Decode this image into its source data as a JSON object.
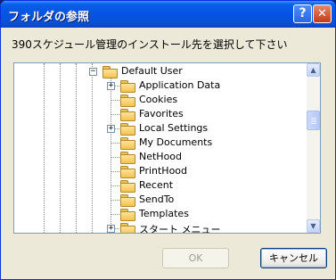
{
  "window": {
    "title": "フォルダの参照"
  },
  "titlebar_buttons": {
    "help": "?",
    "close": "✕"
  },
  "description": "390スケジュール管理のインストール先を選択して下さい",
  "tree": {
    "root": {
      "label": "Default User",
      "expanded": true
    },
    "children": [
      {
        "label": "Application Data",
        "expandable": true
      },
      {
        "label": "Cookies",
        "expandable": false
      },
      {
        "label": "Favorites",
        "expandable": false
      },
      {
        "label": "Local Settings",
        "expandable": true
      },
      {
        "label": "My Documents",
        "expandable": false
      },
      {
        "label": "NetHood",
        "expandable": false
      },
      {
        "label": "PrintHood",
        "expandable": false
      },
      {
        "label": "Recent",
        "expandable": false
      },
      {
        "label": "SendTo",
        "expandable": false
      },
      {
        "label": "Templates",
        "expandable": false
      },
      {
        "label": "スタート メニュー",
        "expandable": true
      }
    ],
    "expander_plus": "+",
    "expander_minus": "−"
  },
  "scrollbar": {
    "up": "▲",
    "down": "▼"
  },
  "buttons": {
    "ok": "OK",
    "cancel": "キャンセル",
    "ok_enabled": false
  },
  "colors": {
    "titlebar": "#0554e3",
    "window_bg": "#ece9d8",
    "tree_border": "#7f9db9"
  }
}
